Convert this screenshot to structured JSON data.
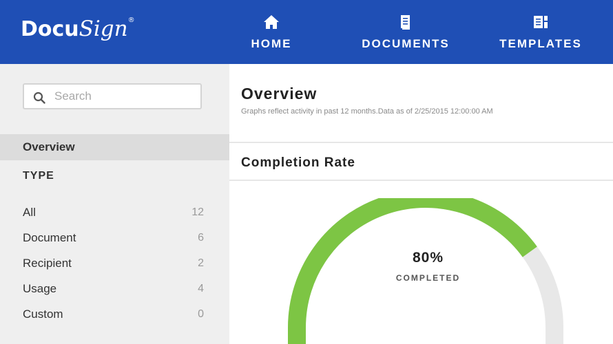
{
  "header": {
    "logo_text_a": "Docu",
    "logo_text_b": "Sign",
    "logo_mark": "®",
    "nav": [
      {
        "label": "HOME",
        "icon": "home-icon"
      },
      {
        "label": "DOCUMENTS",
        "icon": "documents-icon"
      },
      {
        "label": "TEMPLATES",
        "icon": "templates-icon"
      }
    ],
    "bar_color": "#1f4fb5"
  },
  "sidebar": {
    "search_placeholder": "Search",
    "overview_label": "Overview",
    "type_heading": "TYPE",
    "items": [
      {
        "label": "All",
        "count": "12"
      },
      {
        "label": "Document",
        "count": "6"
      },
      {
        "label": "Recipient",
        "count": "2"
      },
      {
        "label": "Usage",
        "count": "4"
      },
      {
        "label": "Custom",
        "count": "0"
      }
    ]
  },
  "main": {
    "title": "Overview",
    "subtitle": "Graphs reflect activity in past 12 months.Data as of 2/25/2015 12:00:00 AM",
    "section_title": "Completion Rate",
    "gauge": {
      "percent_text": "80%",
      "label": "COMPLETED",
      "fraction": 0.8,
      "fill_color": "#7dc544",
      "track_color": "#e8e8e8"
    }
  }
}
